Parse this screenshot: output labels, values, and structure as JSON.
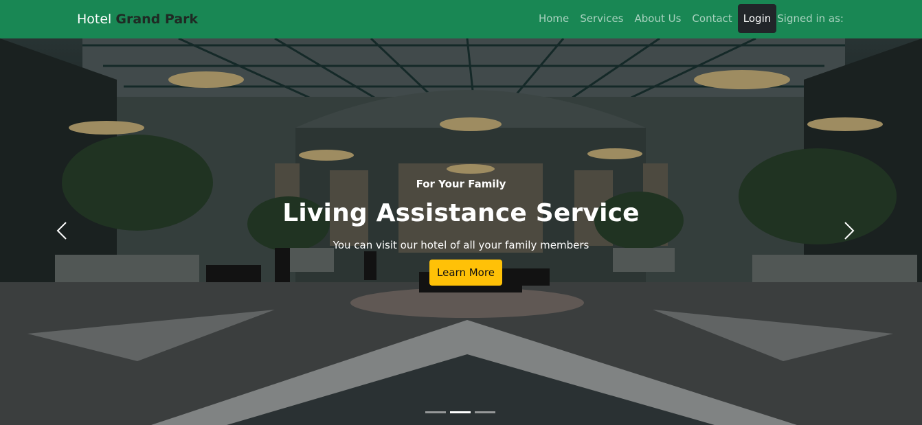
{
  "navbar": {
    "brand_prefix": "Hotel",
    "brand_name": "Grand Park",
    "links": [
      "Home",
      "Services",
      "About Us",
      "Contact"
    ],
    "login_label": "Login",
    "signed_in_label": "Signed in as:"
  },
  "hero": {
    "eyebrow": "For Your Family",
    "title": "Living Assistance Service",
    "subtitle": "You can visit our hotel of all your family members",
    "cta_label": "Learn More",
    "prev_icon": "chevron-left-icon",
    "next_icon": "chevron-right-icon",
    "slides": 3,
    "active_slide": 2
  },
  "colors": {
    "navbar_bg": "#198754",
    "login_bg": "#212529",
    "cta_bg": "#ffc107"
  }
}
